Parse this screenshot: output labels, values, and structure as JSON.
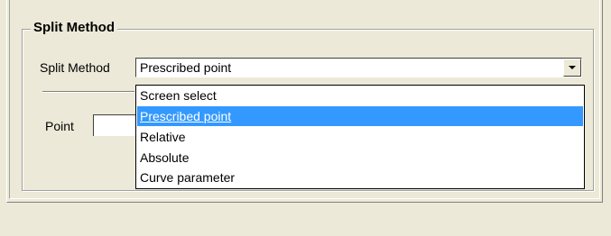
{
  "groupbox": {
    "title": "Split Method"
  },
  "split_method": {
    "label": "Split Method",
    "value": "Prescribed point"
  },
  "point": {
    "label": "Point",
    "value": ""
  },
  "dropdown": {
    "items": [
      {
        "label": "Screen select",
        "selected": false
      },
      {
        "label": "Prescribed point",
        "selected": true
      },
      {
        "label": "Relative",
        "selected": false
      },
      {
        "label": "Absolute",
        "selected": false
      },
      {
        "label": "Curve parameter",
        "selected": false
      }
    ],
    "selection_color": "#3399ff"
  },
  "colors": {
    "dialog_background": "#ece9d8",
    "field_background": "#ffffff"
  },
  "icons": {
    "combo_arrow": "chevron-down-icon"
  }
}
